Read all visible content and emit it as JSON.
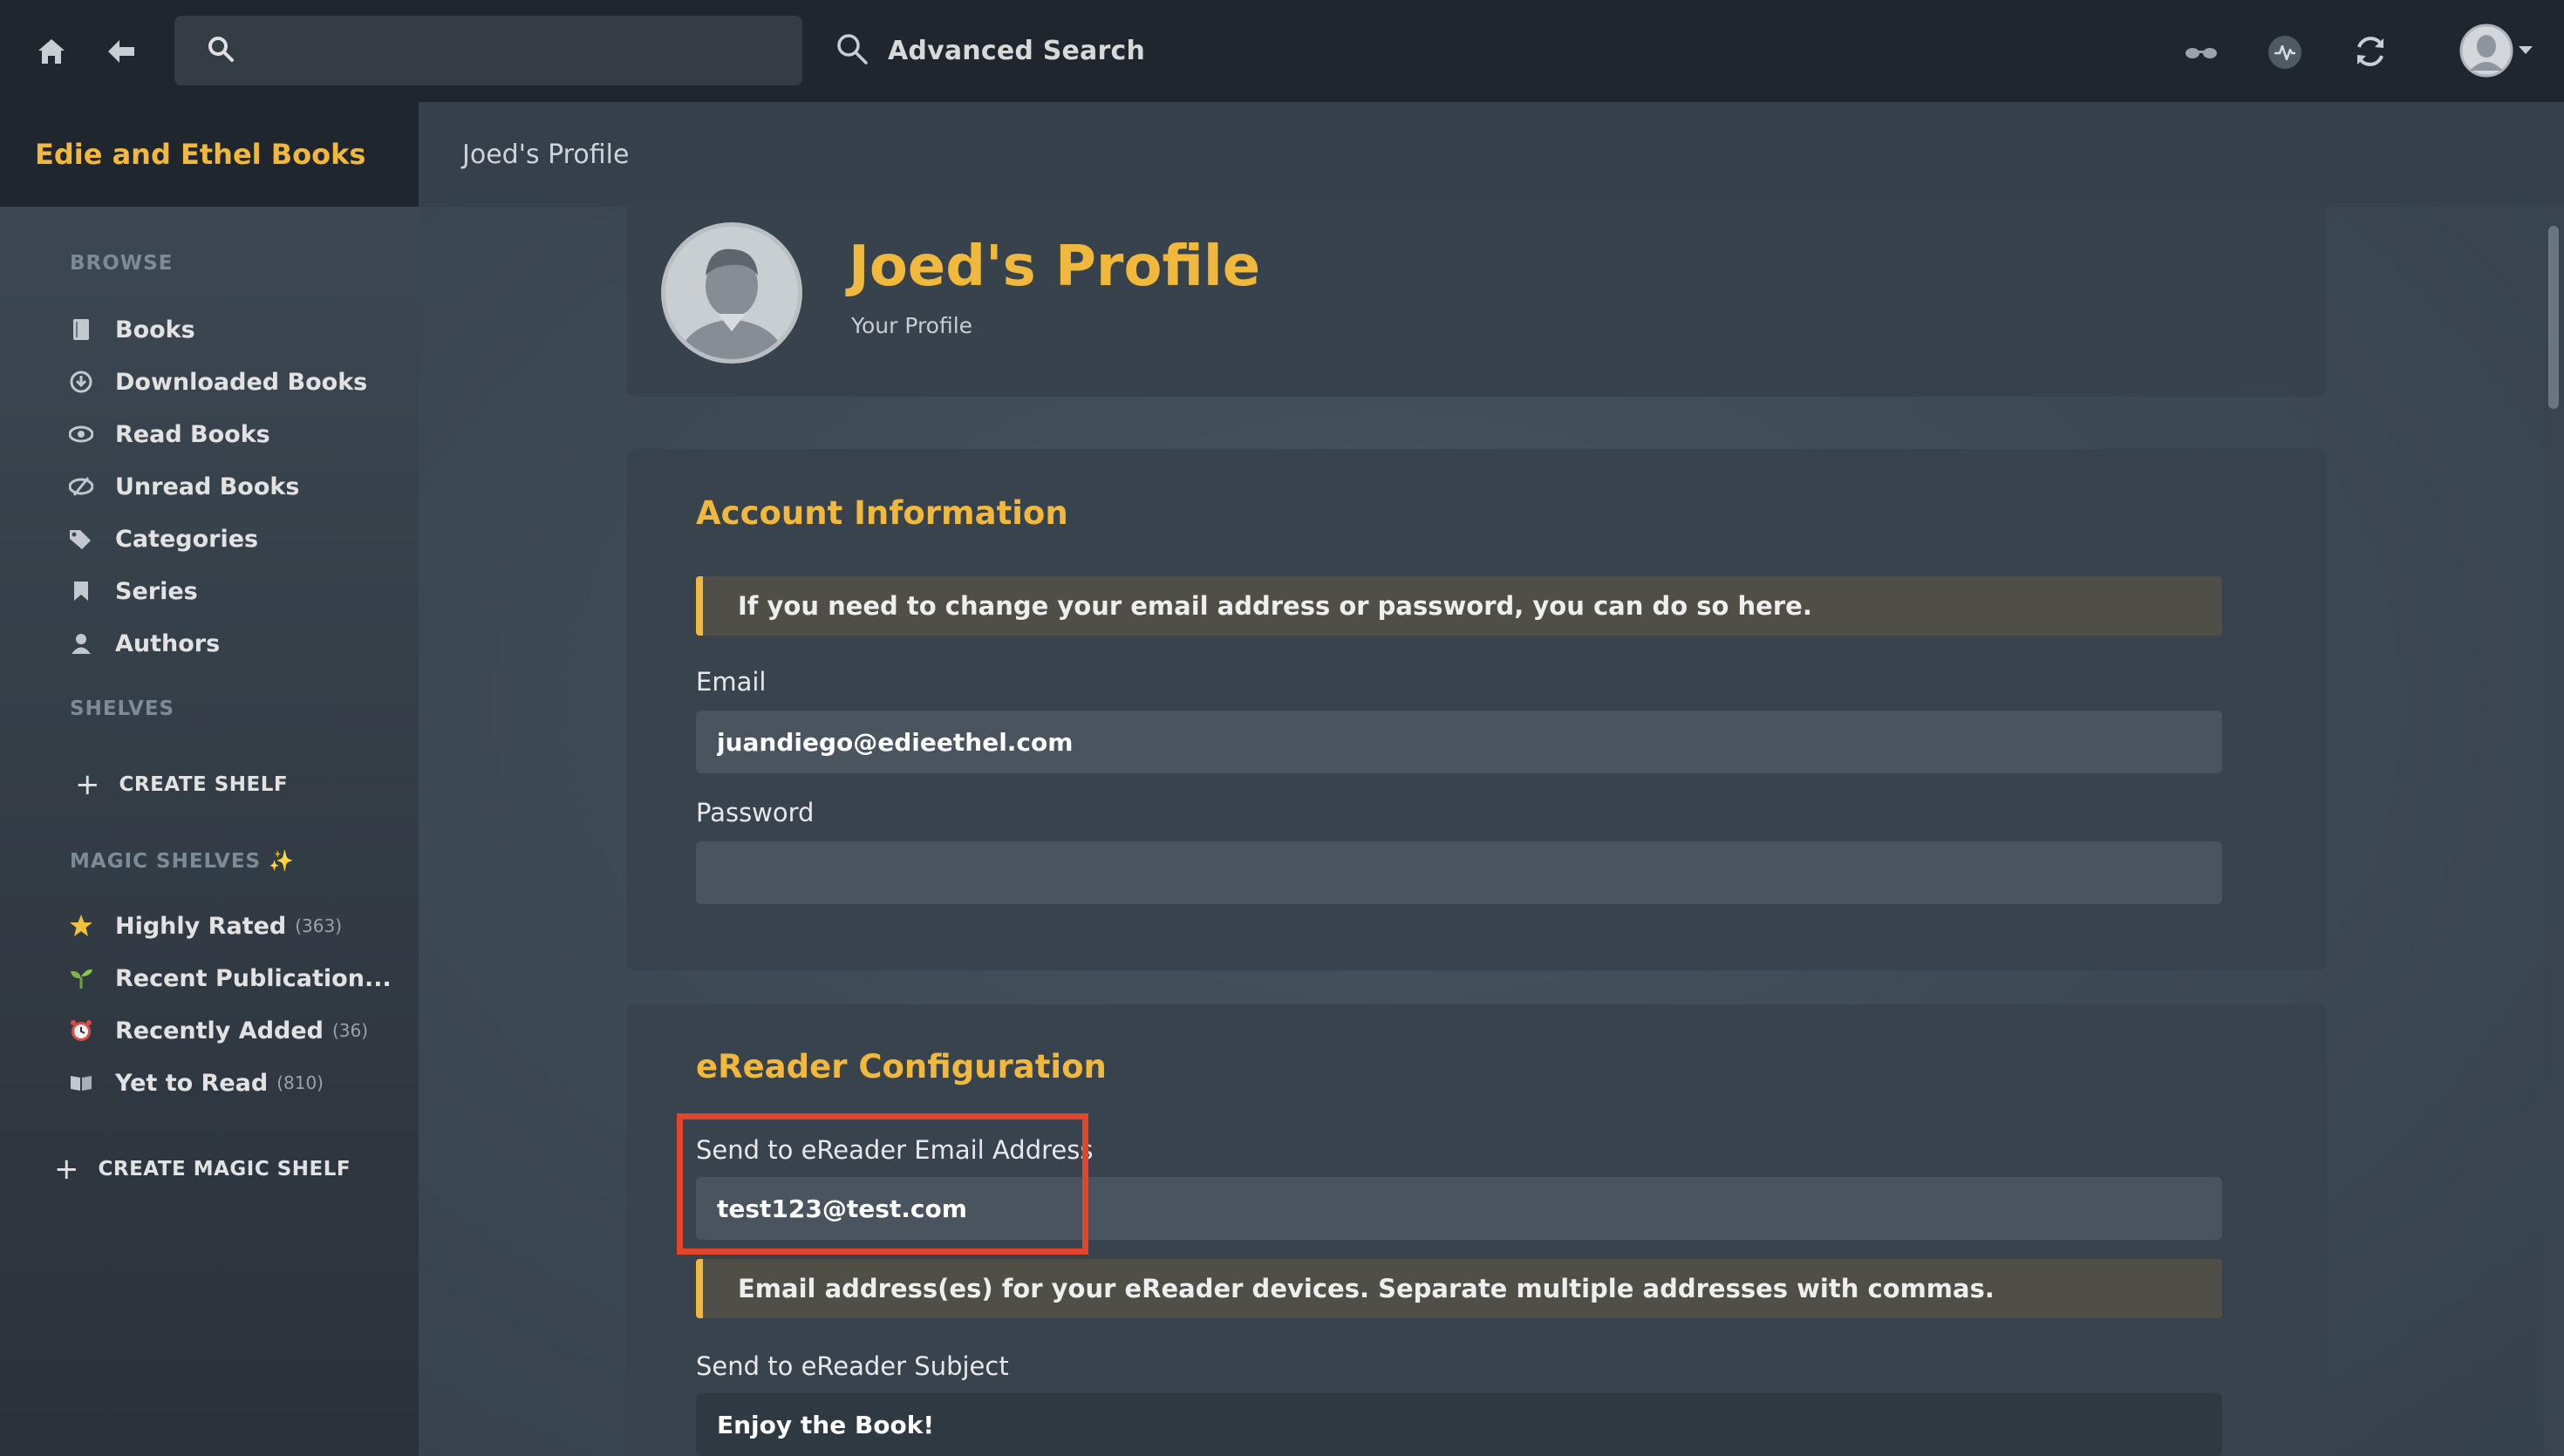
{
  "topbar": {
    "search_placeholder": "",
    "advanced_search_label": "Advanced Search",
    "icons": [
      "home-icon",
      "back-icon",
      "search-icon",
      "reading-glasses-icon",
      "activity-icon",
      "refresh-icon",
      "user-avatar-icon"
    ]
  },
  "sidebar": {
    "library_title": "Edie and Ethel Books",
    "browse_heading": "BROWSE",
    "browse_items": [
      {
        "label": "Books",
        "icon": "book-icon"
      },
      {
        "label": "Downloaded Books",
        "icon": "download-icon"
      },
      {
        "label": "Read Books",
        "icon": "eye-icon"
      },
      {
        "label": "Unread Books",
        "icon": "eye-slash-icon"
      },
      {
        "label": "Categories",
        "icon": "tags-icon"
      },
      {
        "label": "Series",
        "icon": "bookmark-icon"
      },
      {
        "label": "Authors",
        "icon": "person-icon"
      }
    ],
    "shelves_heading": "SHELVES",
    "create_shelf_label": "CREATE SHELF",
    "magic_heading": "MAGIC SHELVES ✨",
    "magic_items": [
      {
        "label": "Highly Rated",
        "count": "(363)",
        "icon": "star-icon"
      },
      {
        "label": "Recent Publication...",
        "count": "",
        "icon": "sprout-icon"
      },
      {
        "label": "Recently Added",
        "count": "(36)",
        "icon": "alarm-clock-icon"
      },
      {
        "label": "Yet to Read",
        "count": "(810)",
        "icon": "open-book-icon"
      }
    ],
    "create_magic_label": "CREATE MAGIC SHELF"
  },
  "header": {
    "breadcrumb": "Joed's Profile"
  },
  "profile": {
    "title": "Joed's Profile",
    "subtitle": "Your Profile"
  },
  "account": {
    "title": "Account Information",
    "notice": "If you need to change your email address or password, you can do so here.",
    "email_label": "Email",
    "email_value": "juandiego@edieethel.com",
    "password_label": "Password",
    "password_value": ""
  },
  "ereader": {
    "title": "eReader Configuration",
    "email_label": "Send to eReader Email Address",
    "email_value": "test123@test.com",
    "notice": "Email address(es) for your eReader devices. Separate multiple addresses with commas.",
    "subject_label": "Send to eReader Subject",
    "subject_value": "Enjoy the Book!"
  },
  "colors": {
    "accent": "#f0b93d",
    "highlight": "#e2442c"
  }
}
